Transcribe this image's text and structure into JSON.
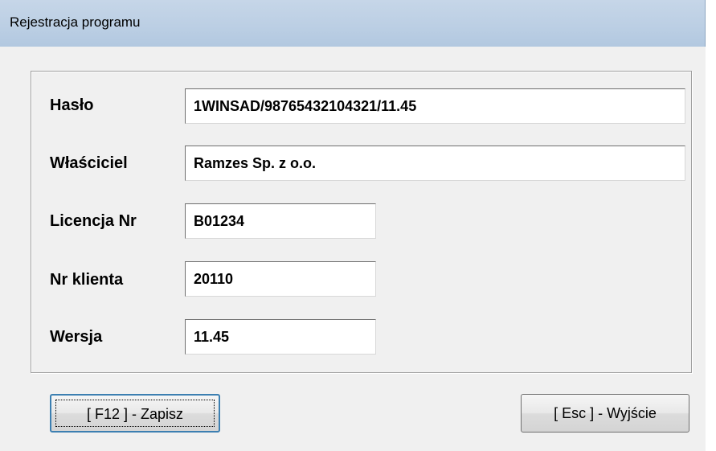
{
  "window": {
    "title": "Rejestracja programu"
  },
  "form": {
    "haslo": {
      "label": "Hasło",
      "value": "1WINSAD/98765432104321/11.45"
    },
    "wlasciciel": {
      "label": "Właściciel",
      "value": "Ramzes Sp. z o.o."
    },
    "licencja": {
      "label": "Licencja Nr",
      "value": "B01234"
    },
    "klient": {
      "label": "Nr klienta",
      "value": "20110"
    },
    "wersja": {
      "label": "Wersja",
      "value": "11.45"
    }
  },
  "buttons": {
    "save_label": "[ F12 ] - Zapisz",
    "exit_label": "[ Esc ] - Wyjście"
  }
}
